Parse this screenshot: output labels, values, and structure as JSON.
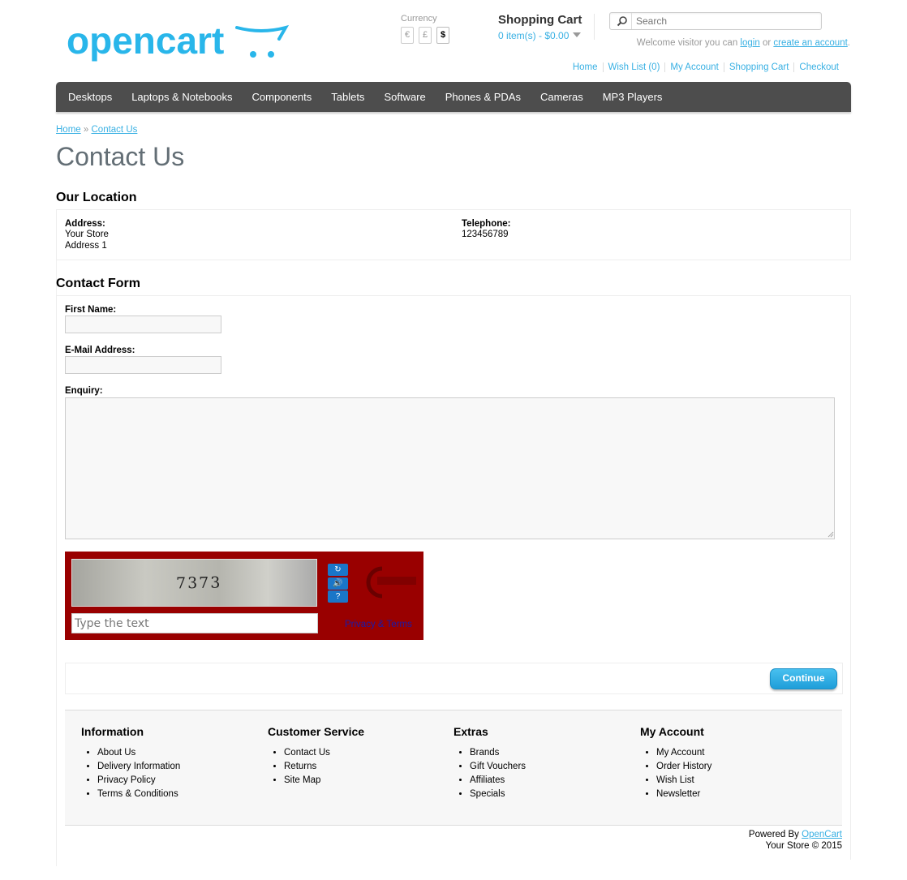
{
  "header": {
    "logo_text": "opencart",
    "currency": {
      "label": "Currency",
      "options": [
        "€",
        "£",
        "$"
      ],
      "active": "$"
    },
    "cart": {
      "title": "Shopping Cart",
      "total": "0 item(s) - $0.00"
    },
    "search": {
      "placeholder": "Search"
    },
    "welcome": {
      "prefix": "Welcome visitor you can",
      "login": "login",
      "or": "or",
      "create": "create an account",
      "suffix": "."
    },
    "links": [
      "Home",
      "Wish List (0)",
      "My Account",
      "Shopping Cart",
      "Checkout"
    ]
  },
  "menu": [
    "Desktops",
    "Laptops & Notebooks",
    "Components",
    "Tablets",
    "Software",
    "Phones & PDAs",
    "Cameras",
    "MP3 Players"
  ],
  "breadcrumb": {
    "home": "Home",
    "sep": "»",
    "current": "Contact Us"
  },
  "page_title": "Contact Us",
  "location": {
    "heading": "Our Location",
    "address_label": "Address:",
    "address_lines": [
      "Your Store",
      "Address 1"
    ],
    "telephone_label": "Telephone:",
    "telephone": "123456789"
  },
  "form": {
    "heading": "Contact Form",
    "first_name_label": "First Name:",
    "email_label": "E-Mail Address:",
    "enquiry_label": "Enquiry:",
    "first_name_value": "",
    "email_value": "",
    "enquiry_value": ""
  },
  "captcha": {
    "code": "7373",
    "input_placeholder": "Type the text",
    "privacy": "Privacy & Terms",
    "colors": {
      "background": "#990000",
      "button": "#1a76c8"
    }
  },
  "continue_label": "Continue",
  "footer": {
    "columns": [
      {
        "title": "Information",
        "items": [
          "About Us",
          "Delivery Information",
          "Privacy Policy",
          "Terms & Conditions"
        ]
      },
      {
        "title": "Customer Service",
        "items": [
          "Contact Us",
          "Returns",
          "Site Map"
        ]
      },
      {
        "title": "Extras",
        "items": [
          "Brands",
          "Gift Vouchers",
          "Affiliates",
          "Specials"
        ]
      },
      {
        "title": "My Account",
        "items": [
          "My Account",
          "Order History",
          "Wish List",
          "Newsletter"
        ]
      }
    ],
    "powered_prefix": "Powered By",
    "powered_link": "OpenCart",
    "copyright": "Your Store © 2015"
  },
  "colors": {
    "accent": "#38B0E3",
    "menu_bg": "#4d4d4d",
    "title": "#636e75"
  }
}
